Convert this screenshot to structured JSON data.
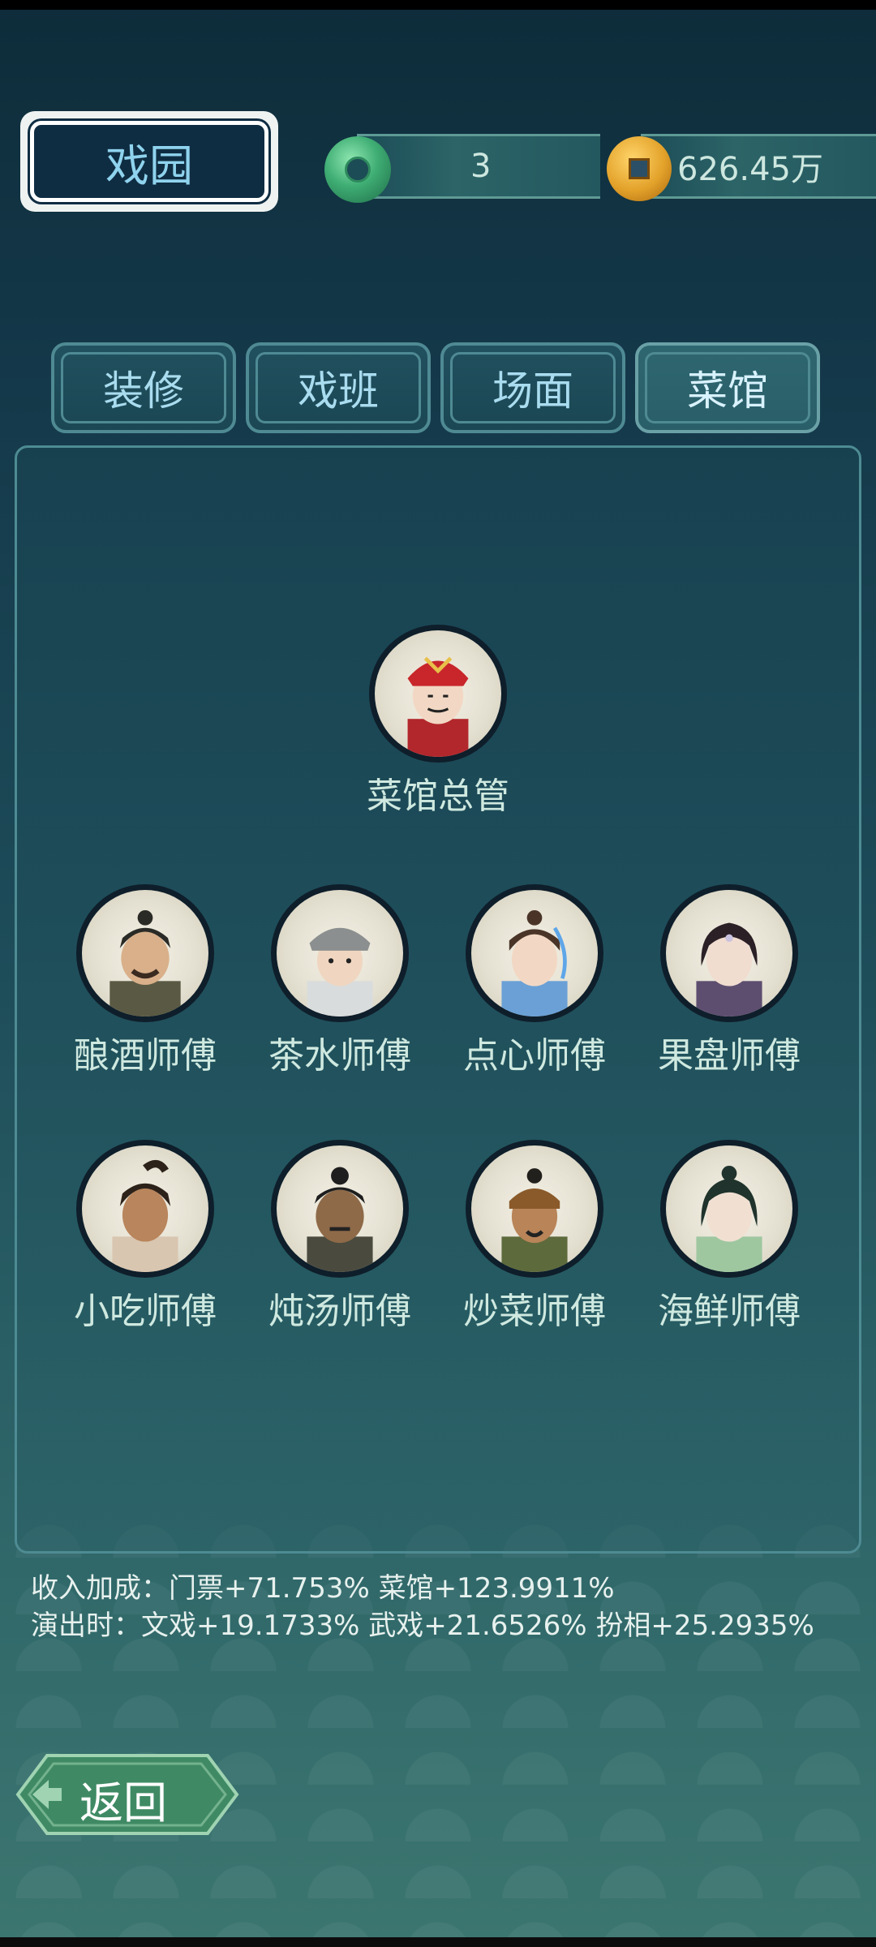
{
  "header": {
    "title": "戏园"
  },
  "resources": {
    "jade": {
      "icon": "jade-disc-icon",
      "value": "3"
    },
    "coin": {
      "icon": "copper-coin-icon",
      "value": "626.45万"
    }
  },
  "tabs": [
    {
      "label": "装修",
      "active": false
    },
    {
      "label": "戏班",
      "active": false
    },
    {
      "label": "场面",
      "active": false
    },
    {
      "label": "菜馆",
      "active": true
    }
  ],
  "manager": {
    "name": "菜馆总管",
    "hat_color": "#c8262a",
    "robe_color": "#b2272c"
  },
  "chefs": [
    {
      "name": "酿酒师傅",
      "hair": "#2a2a26",
      "skin": "#d9b08a",
      "cloth": "#5a5a44"
    },
    {
      "name": "茶水师傅",
      "hair": "#8c8f8f",
      "skin": "#f0d6c0",
      "cloth": "#d9dcdc"
    },
    {
      "name": "点心师傅",
      "hair": "#4a3428",
      "skin": "#f2d8c4",
      "cloth": "#6aa0d6"
    },
    {
      "name": "果盘师傅",
      "hair": "#2b2026",
      "skin": "#f1dcd0",
      "cloth": "#5d4e70"
    },
    {
      "name": "小吃师傅",
      "hair": "#2d221a",
      "skin": "#b9855c",
      "cloth": "#d9c6b0"
    },
    {
      "name": "炖汤师傅",
      "hair": "#1e1e1e",
      "skin": "#8e6a48",
      "cloth": "#4a4a3e"
    },
    {
      "name": "炒菜师傅",
      "hair": "#22201c",
      "skin": "#b88458",
      "cloth": "#5d6a3c"
    },
    {
      "name": "海鲜师傅",
      "hair": "#20332c",
      "skin": "#f1e0d2",
      "cloth": "#9ec7a0"
    }
  ],
  "bonus": {
    "income": "收入加成：门票+71.753% 菜馆+123.9911%",
    "performance": "演出时：文戏+19.1733% 武戏+21.6526% 扮相+25.2935%"
  },
  "back_button": {
    "label": "返回"
  }
}
